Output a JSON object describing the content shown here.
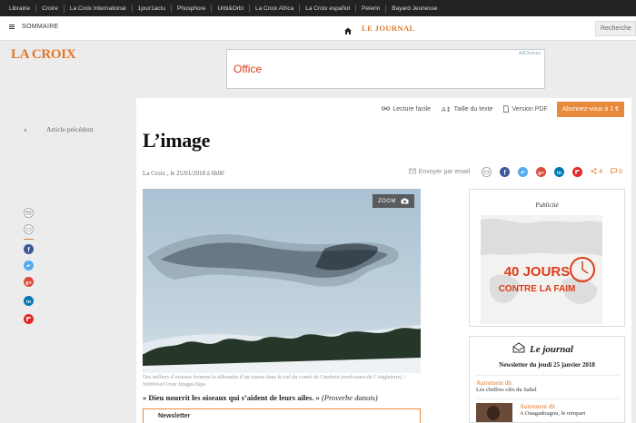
{
  "network_links": [
    "Librairie",
    "Croire",
    "La Croix International",
    "1jour1actu",
    "Phosphore",
    "Urbi&Orbi",
    "La Croix Africa",
    "La Croix español",
    "Pelerin",
    "Bayard Jeunesse"
  ],
  "nav": {
    "menu_label": "SOMMAIRE",
    "journal_label": "LE JOURNAL",
    "search_label": "Recherche"
  },
  "logo_text": "LA CROIX",
  "ad_top": {
    "brand": "Office",
    "ad_choices": "AdChoices"
  },
  "left_rail": {
    "prev_label": "Article précédent"
  },
  "tools": {
    "easy_read": "Lecture facile",
    "text_size": "Taille du texte",
    "pdf": "Version PDF",
    "subscribe": "Abonnez-vous à 1 €"
  },
  "article": {
    "title": "L’image",
    "byline": "La Croix , le 25/01/2018 à 6h00",
    "email_share": "Envoyer par email",
    "share_count": "4",
    "comment_count": "0",
    "zoom_label": "ZOOM",
    "caption": "Des milliers d’oiseaux forment la silhouette d’un oiseau dans le ciel du comté de Cumbria (nord-ouest de l’Angleterre). / WittWoo/Cover Images/Sipa",
    "quote_text": "« Dieu nourrit les oiseaux qui s’aident de leurs ailes. »",
    "quote_source": "(Proverbe danois)",
    "newsletter_label": "Newsletter"
  },
  "sidebar": {
    "pub_label": "Publicité",
    "ad_line1": "40 JOURS",
    "ad_line2": "CONTRE LA FAIM",
    "journal_title": "Le journal",
    "journal_date": "Newsletter du jeudi 25 janvier 2018",
    "item1_category": "Autrement dit",
    "item1_title": "Les chiffres clés du Sahel",
    "item2_category": "Autrement dit",
    "item2_title": "A Ouagadougou, le rempart"
  },
  "colors": {
    "accent": "#e0782a",
    "facebook": "#3b5998",
    "twitter": "#55acee",
    "googleplus": "#dd4b39",
    "linkedin": "#0077b5",
    "flipboard": "#e12828"
  }
}
